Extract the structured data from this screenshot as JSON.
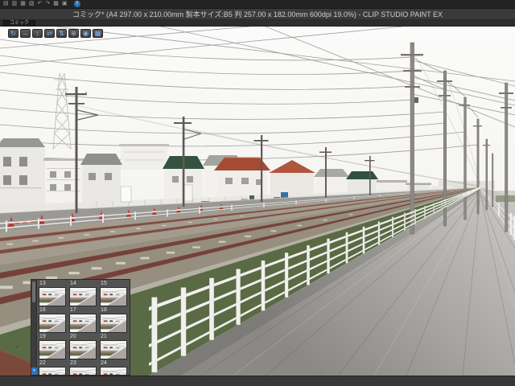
{
  "window": {
    "title": "コミック* (A4 297.00 x 210.00mm 製本サイズ:B5 判 257.00 x 182.00mm 600dpi 19.0%) - CLIP STUDIO PAINT EX"
  },
  "command_bar": {
    "icons": [
      {
        "name": "new-canvas-icon",
        "glyph": "▤"
      },
      {
        "name": "open-file-icon",
        "glyph": "▥"
      },
      {
        "name": "save-icon",
        "glyph": "▦"
      },
      {
        "name": "print-icon",
        "glyph": "▧"
      },
      {
        "name": "undo-icon",
        "glyph": "↶"
      },
      {
        "name": "redo-icon",
        "glyph": "↷"
      },
      {
        "name": "grid-icon",
        "glyph": "▩"
      },
      {
        "name": "workspace-icon",
        "glyph": "▣"
      }
    ],
    "help_glyph": "?"
  },
  "canvas_tab": {
    "label": "コミック"
  },
  "nav3d": {
    "buttons": [
      {
        "name": "camera-rotate-icon",
        "glyph": "↻"
      },
      {
        "name": "camera-pan-icon",
        "glyph": "↔"
      },
      {
        "name": "camera-dolly-icon",
        "glyph": "↕"
      },
      {
        "name": "model-move-icon",
        "glyph": "⇄"
      },
      {
        "name": "model-rotate-icon",
        "glyph": "⇅"
      },
      {
        "name": "model-snap-icon",
        "glyph": "⊕"
      },
      {
        "name": "camera-target-icon",
        "glyph": "◉"
      },
      {
        "name": "ground-grid-icon",
        "glyph": "▦"
      }
    ]
  },
  "pages_panel": {
    "scroll_down_glyph": "▾",
    "items": [
      {
        "number": "13"
      },
      {
        "number": "14"
      },
      {
        "number": "15"
      },
      {
        "number": "16"
      },
      {
        "number": "17"
      },
      {
        "number": "18"
      },
      {
        "number": "19"
      },
      {
        "number": "20"
      },
      {
        "number": "21"
      },
      {
        "number": "22"
      },
      {
        "number": "23"
      },
      {
        "number": "24"
      }
    ]
  },
  "scene": {
    "description": "3D suburban railway scene preview",
    "colors": {
      "sky": "#f5f5f3",
      "roof_red": "#a54b33",
      "roof_green": "#35523f",
      "fence_white": "#f1f0ed",
      "grass": "#596a45",
      "path_gray": "#a09e9a",
      "rail_rust": "#74413a"
    }
  }
}
